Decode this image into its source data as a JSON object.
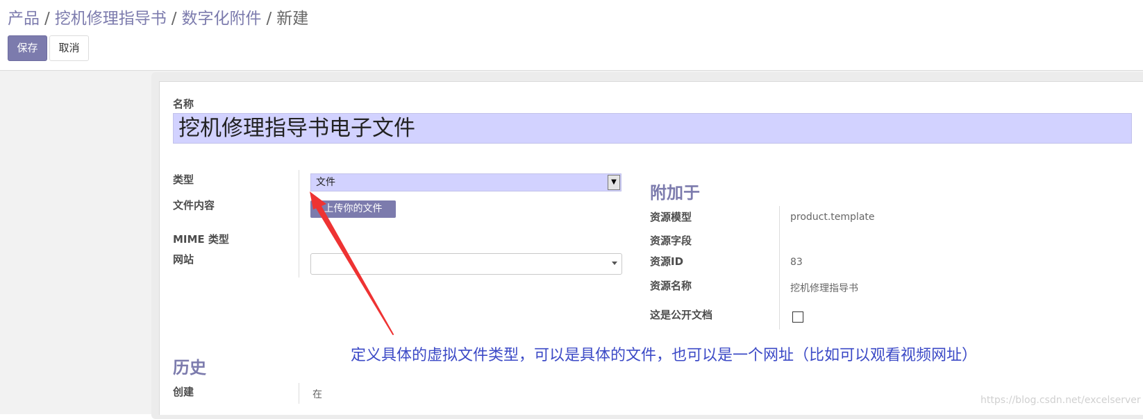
{
  "breadcrumb": {
    "items": [
      "产品",
      "挖机修理指导书",
      "数字化附件"
    ],
    "separator": "/",
    "current": "新建"
  },
  "toolbar": {
    "save_label": "保存",
    "cancel_label": "取消"
  },
  "form": {
    "name_label": "名称",
    "name_value": "挖机修理指导书电子文件",
    "fields": {
      "type_label": "类型",
      "type_value": "文件",
      "file_content_label": "文件内容",
      "upload_button_label": "上传你的文件",
      "mime_label": "MIME 类型",
      "website_label": "网站",
      "website_value": ""
    },
    "attached_to": {
      "title": "附加于",
      "res_model_label": "资源模型",
      "res_model_value": "product.template",
      "res_field_label": "资源字段",
      "res_field_value": "",
      "res_id_label": "资源ID",
      "res_id_value": "83",
      "res_name_label": "资源名称",
      "res_name_value": "挖机修理指导书",
      "public_label": "这是公开文档",
      "public_checked": false
    },
    "history": {
      "title": "历史",
      "created_label": "创建",
      "created_value": "在"
    }
  },
  "annotation": {
    "text": "定义具体的虚拟文件类型，可以是具体的文件，也可以是一个网址（比如可以观看视频网址）",
    "color": "#3b49c6",
    "arrow_color": "#ee3333"
  },
  "watermark": "https://blog.csdn.net/excelserver",
  "colors": {
    "accent": "#7c7bad",
    "required_field_bg": "#d2d2ff"
  }
}
